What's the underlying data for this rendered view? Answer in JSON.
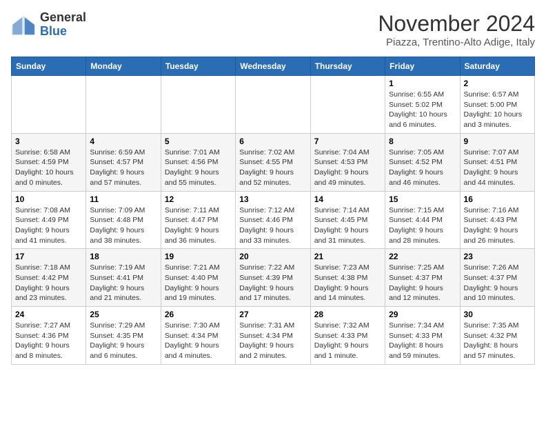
{
  "logo": {
    "general": "General",
    "blue": "Blue"
  },
  "header": {
    "month": "November 2024",
    "location": "Piazza, Trentino-Alto Adige, Italy"
  },
  "days_of_week": [
    "Sunday",
    "Monday",
    "Tuesday",
    "Wednesday",
    "Thursday",
    "Friday",
    "Saturday"
  ],
  "weeks": [
    [
      {
        "day": "",
        "info": ""
      },
      {
        "day": "",
        "info": ""
      },
      {
        "day": "",
        "info": ""
      },
      {
        "day": "",
        "info": ""
      },
      {
        "day": "",
        "info": ""
      },
      {
        "day": "1",
        "info": "Sunrise: 6:55 AM\nSunset: 5:02 PM\nDaylight: 10 hours and 6 minutes."
      },
      {
        "day": "2",
        "info": "Sunrise: 6:57 AM\nSunset: 5:00 PM\nDaylight: 10 hours and 3 minutes."
      }
    ],
    [
      {
        "day": "3",
        "info": "Sunrise: 6:58 AM\nSunset: 4:59 PM\nDaylight: 10 hours and 0 minutes."
      },
      {
        "day": "4",
        "info": "Sunrise: 6:59 AM\nSunset: 4:57 PM\nDaylight: 9 hours and 57 minutes."
      },
      {
        "day": "5",
        "info": "Sunrise: 7:01 AM\nSunset: 4:56 PM\nDaylight: 9 hours and 55 minutes."
      },
      {
        "day": "6",
        "info": "Sunrise: 7:02 AM\nSunset: 4:55 PM\nDaylight: 9 hours and 52 minutes."
      },
      {
        "day": "7",
        "info": "Sunrise: 7:04 AM\nSunset: 4:53 PM\nDaylight: 9 hours and 49 minutes."
      },
      {
        "day": "8",
        "info": "Sunrise: 7:05 AM\nSunset: 4:52 PM\nDaylight: 9 hours and 46 minutes."
      },
      {
        "day": "9",
        "info": "Sunrise: 7:07 AM\nSunset: 4:51 PM\nDaylight: 9 hours and 44 minutes."
      }
    ],
    [
      {
        "day": "10",
        "info": "Sunrise: 7:08 AM\nSunset: 4:49 PM\nDaylight: 9 hours and 41 minutes."
      },
      {
        "day": "11",
        "info": "Sunrise: 7:09 AM\nSunset: 4:48 PM\nDaylight: 9 hours and 38 minutes."
      },
      {
        "day": "12",
        "info": "Sunrise: 7:11 AM\nSunset: 4:47 PM\nDaylight: 9 hours and 36 minutes."
      },
      {
        "day": "13",
        "info": "Sunrise: 7:12 AM\nSunset: 4:46 PM\nDaylight: 9 hours and 33 minutes."
      },
      {
        "day": "14",
        "info": "Sunrise: 7:14 AM\nSunset: 4:45 PM\nDaylight: 9 hours and 31 minutes."
      },
      {
        "day": "15",
        "info": "Sunrise: 7:15 AM\nSunset: 4:44 PM\nDaylight: 9 hours and 28 minutes."
      },
      {
        "day": "16",
        "info": "Sunrise: 7:16 AM\nSunset: 4:43 PM\nDaylight: 9 hours and 26 minutes."
      }
    ],
    [
      {
        "day": "17",
        "info": "Sunrise: 7:18 AM\nSunset: 4:42 PM\nDaylight: 9 hours and 23 minutes."
      },
      {
        "day": "18",
        "info": "Sunrise: 7:19 AM\nSunset: 4:41 PM\nDaylight: 9 hours and 21 minutes."
      },
      {
        "day": "19",
        "info": "Sunrise: 7:21 AM\nSunset: 4:40 PM\nDaylight: 9 hours and 19 minutes."
      },
      {
        "day": "20",
        "info": "Sunrise: 7:22 AM\nSunset: 4:39 PM\nDaylight: 9 hours and 17 minutes."
      },
      {
        "day": "21",
        "info": "Sunrise: 7:23 AM\nSunset: 4:38 PM\nDaylight: 9 hours and 14 minutes."
      },
      {
        "day": "22",
        "info": "Sunrise: 7:25 AM\nSunset: 4:37 PM\nDaylight: 9 hours and 12 minutes."
      },
      {
        "day": "23",
        "info": "Sunrise: 7:26 AM\nSunset: 4:37 PM\nDaylight: 9 hours and 10 minutes."
      }
    ],
    [
      {
        "day": "24",
        "info": "Sunrise: 7:27 AM\nSunset: 4:36 PM\nDaylight: 9 hours and 8 minutes."
      },
      {
        "day": "25",
        "info": "Sunrise: 7:29 AM\nSunset: 4:35 PM\nDaylight: 9 hours and 6 minutes."
      },
      {
        "day": "26",
        "info": "Sunrise: 7:30 AM\nSunset: 4:34 PM\nDaylight: 9 hours and 4 minutes."
      },
      {
        "day": "27",
        "info": "Sunrise: 7:31 AM\nSunset: 4:34 PM\nDaylight: 9 hours and 2 minutes."
      },
      {
        "day": "28",
        "info": "Sunrise: 7:32 AM\nSunset: 4:33 PM\nDaylight: 9 hours and 1 minute."
      },
      {
        "day": "29",
        "info": "Sunrise: 7:34 AM\nSunset: 4:33 PM\nDaylight: 8 hours and 59 minutes."
      },
      {
        "day": "30",
        "info": "Sunrise: 7:35 AM\nSunset: 4:32 PM\nDaylight: 8 hours and 57 minutes."
      }
    ]
  ]
}
